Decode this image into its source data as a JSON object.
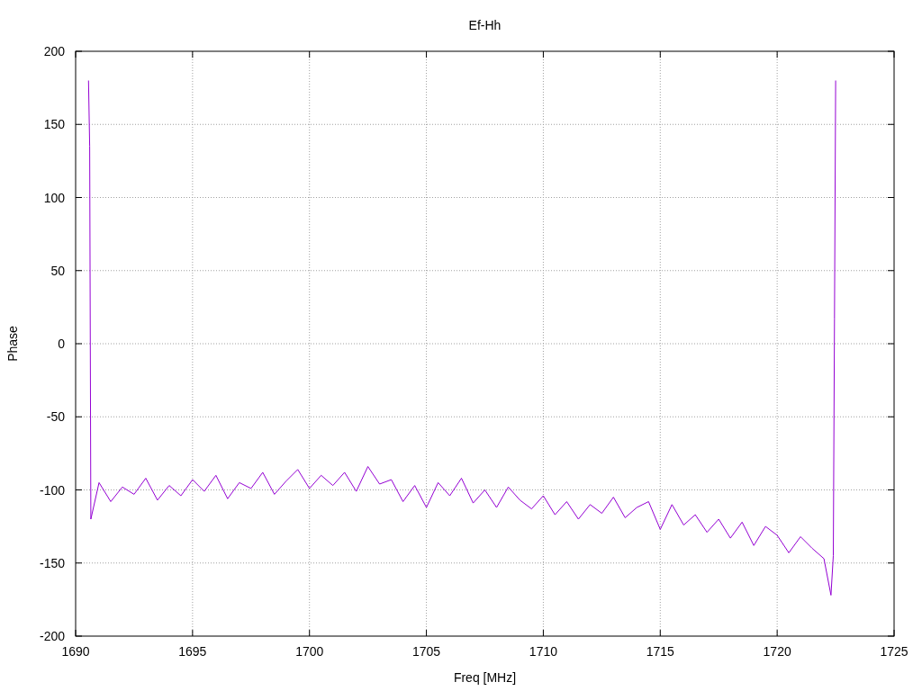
{
  "chart_data": {
    "type": "line",
    "title": "Ef-Hh",
    "xlabel": "Freq [MHz]",
    "ylabel": "Phase",
    "x": [
      1690.55,
      1690.6,
      1690.65,
      1691,
      1691.5,
      1692,
      1692.5,
      1693,
      1693.5,
      1694,
      1694.5,
      1695,
      1695.5,
      1696,
      1696.5,
      1697,
      1697.5,
      1698,
      1698.5,
      1699,
      1699.5,
      1700,
      1700.5,
      1701,
      1701.5,
      1702,
      1702.5,
      1703,
      1703.5,
      1704,
      1704.5,
      1705,
      1705.5,
      1706,
      1706.5,
      1707,
      1707.5,
      1708,
      1708.5,
      1709,
      1709.5,
      1710,
      1710.5,
      1711,
      1711.5,
      1712,
      1712.5,
      1713,
      1713.5,
      1714,
      1714.5,
      1715,
      1715.5,
      1716,
      1716.5,
      1717,
      1717.5,
      1718,
      1718.5,
      1719,
      1719.5,
      1720,
      1720.5,
      1721,
      1721.5,
      1722,
      1722.3,
      1722.4,
      1722.45,
      1722.5
    ],
    "series": [
      {
        "color": "#9400d3",
        "values": [
          180,
          135,
          -120,
          -95,
          -108,
          -98,
          -103,
          -92,
          -107,
          -97,
          -104,
          -93,
          -101,
          -90,
          -106,
          -95,
          -99,
          -88,
          -103,
          -94,
          -86,
          -99,
          -90,
          -97,
          -88,
          -101,
          -84,
          -96,
          -93,
          -108,
          -97,
          -112,
          -95,
          -104,
          -92,
          -109,
          -100,
          -112,
          -98,
          -107,
          -113,
          -104,
          -117,
          -108,
          -120,
          -110,
          -116,
          -105,
          -119,
          -112,
          -108,
          -127,
          -110,
          -124,
          -117,
          -129,
          -120,
          -133,
          -122,
          -138,
          -125,
          -131,
          -143,
          -132,
          -140,
          -147,
          -172,
          -145,
          17,
          180
        ]
      }
    ],
    "xlim": [
      1690,
      1725
    ],
    "ylim": [
      -200,
      200
    ],
    "xticks": [
      1690,
      1695,
      1700,
      1705,
      1710,
      1715,
      1720,
      1725
    ],
    "yticks": [
      -200,
      -150,
      -100,
      -50,
      0,
      50,
      100,
      150,
      200
    ],
    "grid": true
  }
}
